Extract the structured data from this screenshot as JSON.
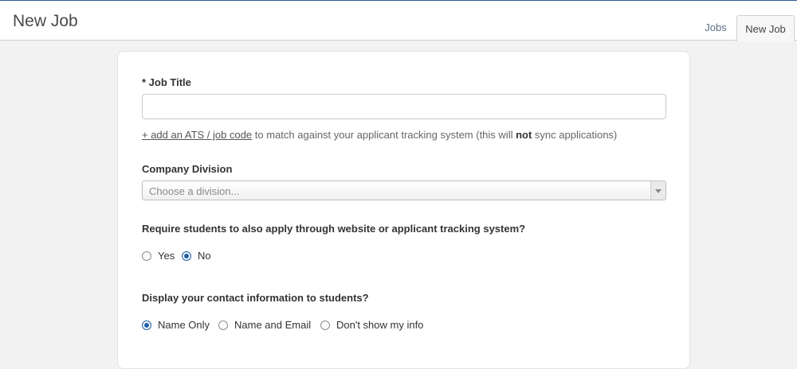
{
  "header": {
    "title": "New Job",
    "tabs": [
      {
        "label": "Jobs"
      },
      {
        "label": "New Job"
      }
    ]
  },
  "form": {
    "job_title": {
      "label": "* Job Title",
      "value": "",
      "placeholder": ""
    },
    "ats_helper": {
      "link": "+ add an ATS / job code",
      "text_before_bold": " to match against your applicant tracking system (this will ",
      "bold": "not",
      "text_after_bold": " sync applications)"
    },
    "company_division": {
      "label": "Company Division",
      "placeholder": "Choose a division..."
    },
    "require_apply": {
      "label": "Require students to also apply through website or applicant tracking system?",
      "options": [
        {
          "label": "Yes",
          "checked": false
        },
        {
          "label": "No",
          "checked": true
        }
      ]
    },
    "display_contact": {
      "label": "Display your contact information to students?",
      "options": [
        {
          "label": "Name Only",
          "checked": true
        },
        {
          "label": "Name and Email",
          "checked": false
        },
        {
          "label": "Don't show my info",
          "checked": false
        }
      ]
    }
  },
  "colors": {
    "accent": "#1f5fa6",
    "top_border": "#2c5a93",
    "background": "#f2f2f2"
  }
}
